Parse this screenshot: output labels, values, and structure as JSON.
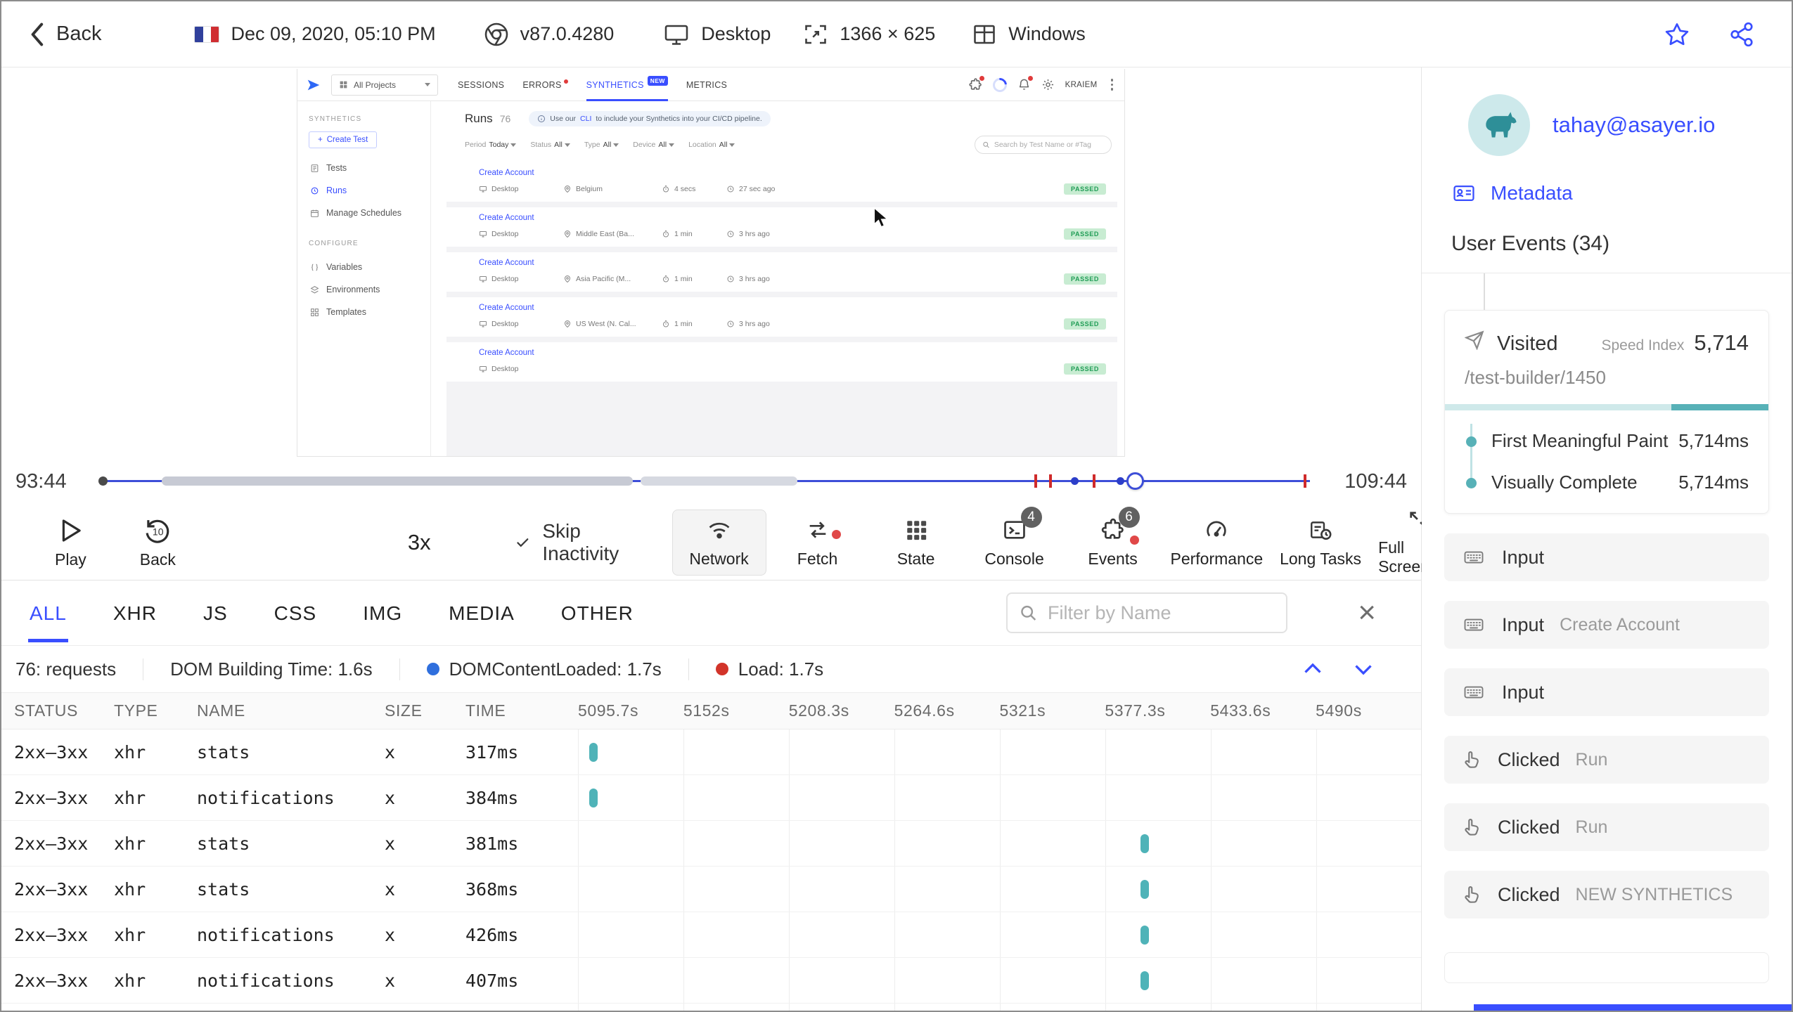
{
  "header": {
    "back": "Back",
    "datetime": "Dec 09, 2020, 05:10 PM",
    "browser_version": "v87.0.4280",
    "device": "Desktop",
    "resolution": "1366 × 625",
    "os": "Windows"
  },
  "app": {
    "nav": {
      "project": "All Projects",
      "tabs": {
        "sessions": "SESSIONS",
        "errors": "ERRORS",
        "synthetics": "SYNTHETICS",
        "metrics": "METRICS"
      },
      "new_badge": "NEW",
      "user": "KRAIEM"
    },
    "sidebar": {
      "section_synthetics": "SYNTHETICS",
      "create_test": "Create Test",
      "tests": "Tests",
      "runs": "Runs",
      "manage_schedules": "Manage Schedules",
      "section_configure": "CONFIGURE",
      "variables": "Variables",
      "environments": "Environments",
      "templates": "Templates"
    },
    "main": {
      "title": "Runs",
      "count": "76",
      "banner_pre": "Use our",
      "banner_link": "CLI",
      "banner_post": "to include your Synthetics into your CI/CD pipeline.",
      "filters": [
        {
          "label": "Period",
          "value": "Today"
        },
        {
          "label": "Status",
          "value": "All"
        },
        {
          "label": "Type",
          "value": "All"
        },
        {
          "label": "Device",
          "value": "All"
        },
        {
          "label": "Location",
          "value": "All"
        }
      ],
      "search_placeholder": "Search by Test Name or #Tag",
      "runs": [
        {
          "name": "Create Account",
          "device": "Desktop",
          "location": "Belgium",
          "duration": "4 secs",
          "ago": "27 sec ago",
          "status": "PASSED"
        },
        {
          "name": "Create Account",
          "device": "Desktop",
          "location": "Middle East (Ba...",
          "duration": "1 min",
          "ago": "3 hrs ago",
          "status": "PASSED"
        },
        {
          "name": "Create Account",
          "device": "Desktop",
          "location": "Asia Pacific (M...",
          "duration": "1 min",
          "ago": "3 hrs ago",
          "status": "PASSED"
        },
        {
          "name": "Create Account",
          "device": "Desktop",
          "location": "US West (N. Cal...",
          "duration": "1 min",
          "ago": "3 hrs ago",
          "status": "PASSED"
        },
        {
          "name": "Create Account",
          "device": "Desktop",
          "status": "PASSED"
        }
      ]
    }
  },
  "timeline": {
    "current": "93:44",
    "total": "109:44"
  },
  "controls": {
    "play": "Play",
    "back": "Back",
    "speed": "3x",
    "skip_inactivity": "Skip Inactivity",
    "toggles": [
      {
        "label": "Network"
      },
      {
        "label": "Fetch"
      },
      {
        "label": "State"
      },
      {
        "label": "Console",
        "badge": "4"
      },
      {
        "label": "Events",
        "badge": "6"
      },
      {
        "label": "Performance"
      },
      {
        "label": "Long Tasks"
      },
      {
        "label": "Full Screen"
      }
    ]
  },
  "network": {
    "tabs": [
      "ALL",
      "XHR",
      "JS",
      "CSS",
      "IMG",
      "MEDIA",
      "OTHER"
    ],
    "filter_placeholder": "Filter by Name",
    "summary": {
      "requests": "76: requests",
      "dom_building": "DOM Building Time: 1.6s",
      "dcl": "DOMContentLoaded: 1.7s",
      "load": "Load: 1.7s"
    },
    "columns": {
      "status": "STATUS",
      "type": "TYPE",
      "name": "NAME",
      "size": "SIZE",
      "time": "TIME"
    },
    "time_ticks": [
      "5095.7s",
      "5152s",
      "5208.3s",
      "5264.6s",
      "5321s",
      "5377.3s",
      "5433.6s",
      "5490s"
    ],
    "rows": [
      {
        "status": "2xx–3xx",
        "type": "xhr",
        "name": "stats",
        "size": "x",
        "time": "317ms"
      },
      {
        "status": "2xx–3xx",
        "type": "xhr",
        "name": "notifications",
        "size": "x",
        "time": "384ms"
      },
      {
        "status": "2xx–3xx",
        "type": "xhr",
        "name": "stats",
        "size": "x",
        "time": "381ms"
      },
      {
        "status": "2xx–3xx",
        "type": "xhr",
        "name": "stats",
        "size": "x",
        "time": "368ms"
      },
      {
        "status": "2xx–3xx",
        "type": "xhr",
        "name": "notifications",
        "size": "x",
        "time": "426ms"
      },
      {
        "status": "2xx–3xx",
        "type": "xhr",
        "name": "notifications",
        "size": "x",
        "time": "407ms"
      }
    ]
  },
  "user_panel": {
    "email": "tahay@asayer.io",
    "metadata": "Metadata",
    "events_title": "User Events (34)",
    "visited": {
      "label": "Visited",
      "speed_index_label": "Speed Index",
      "speed_index": "5,714",
      "url": "/test-builder/1450",
      "fmp_label": "First Meaningful Paint",
      "fmp_value": "5,714ms",
      "vc_label": "Visually Complete",
      "vc_value": "5,714ms"
    },
    "events": [
      {
        "type": "input",
        "label": "Input",
        "value": ""
      },
      {
        "type": "input",
        "label": "Input",
        "value": "Create Account"
      },
      {
        "type": "input",
        "label": "Input",
        "value": ""
      },
      {
        "type": "click",
        "label": "Clicked",
        "value": "Run"
      },
      {
        "type": "click",
        "label": "Clicked",
        "value": "Run"
      },
      {
        "type": "click",
        "label": "Clicked",
        "value": "NEW SYNTHETICS"
      }
    ]
  }
}
